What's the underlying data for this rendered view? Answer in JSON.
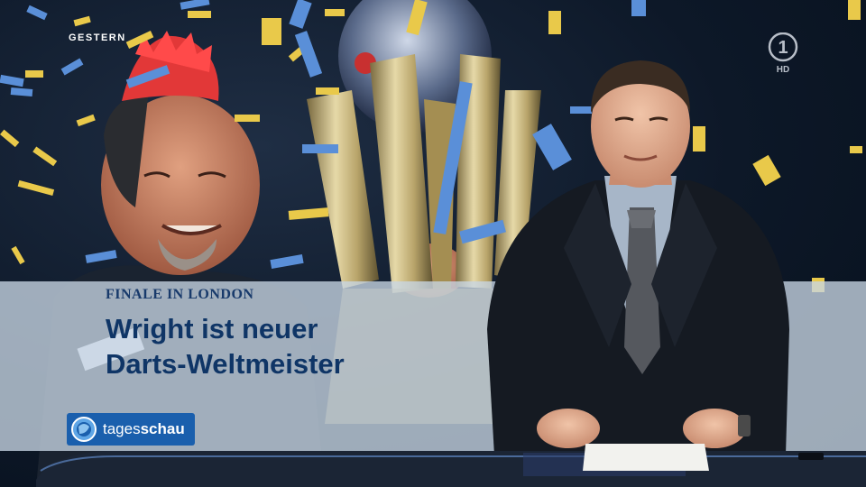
{
  "broadcast": {
    "time_label": "GESTERN",
    "channel_logo": "ARD Das Erste HD",
    "channel_logo_mark": "1",
    "channel_logo_hd": "HD"
  },
  "lower_third": {
    "kicker": "FINALE IN LONDON",
    "headline_line1": "Wright ist neuer",
    "headline_line2": "Darts-Weltmeister"
  },
  "show_logo": {
    "text_regular": "tages",
    "text_bold": "schau"
  },
  "colors": {
    "band": "#c8d6e4",
    "headline": "#0f3566",
    "logo_blue": "#1a5fad",
    "confetti_gold": "#e9c94a",
    "confetti_blue": "#5a8fd8"
  }
}
